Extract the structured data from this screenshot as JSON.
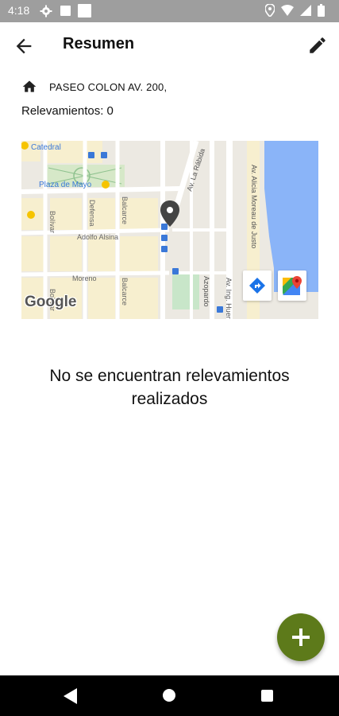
{
  "status_bar": {
    "time": "4:18",
    "icons": [
      "gear-icon",
      "notification-square-icon",
      "notification-square-icon",
      "location-icon",
      "wifi-icon",
      "signal-icon",
      "battery-icon"
    ]
  },
  "app_bar": {
    "title": "Resumen",
    "back_icon": "arrow-back-icon",
    "edit_icon": "pencil-icon"
  },
  "location": {
    "address": "PASEO COLON AV. 200,",
    "surveys_label": "Relevamientos: 0"
  },
  "map": {
    "labels": {
      "catedral": "Catedral",
      "plaza": "Plaza de Mayo",
      "la_rabida": "Av. La Rábida",
      "alicia": "Av. Alicia Moreau de Justo",
      "adolfo": "Adolfo Alsina",
      "moreno": "Moreno",
      "bolivar1": "Bolívar",
      "bolivar2": "Bolívar",
      "defensa": "Defensa",
      "balcarce1": "Balcarce",
      "balcarce2": "Balcarce",
      "azopardo": "Azopardo",
      "av_ing": "Av. Ing. Huergo",
      "google": "Google"
    },
    "colors": {
      "land": "#ece9e2",
      "blocks": "#f7efcf",
      "water": "#8ab4f8",
      "park": "#c8e6c9",
      "road": "#ffffff",
      "marker": "#444444"
    },
    "buttons": [
      "directions-icon",
      "google-maps-icon"
    ]
  },
  "empty_state": {
    "message": "No se encuentran relevamientos realizados"
  },
  "fab": {
    "icon": "plus-icon",
    "color": "#5d7a1a"
  },
  "nav_bar": {
    "icons": [
      "nav-back-icon",
      "nav-home-icon",
      "nav-recents-icon"
    ]
  }
}
